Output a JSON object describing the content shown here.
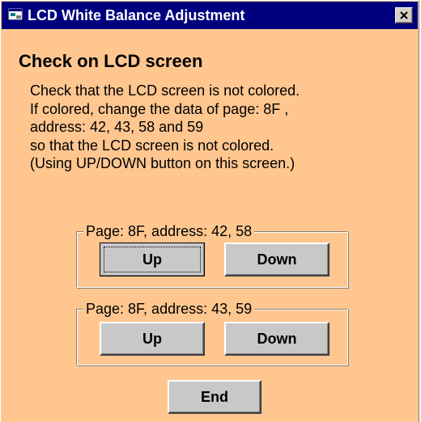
{
  "window": {
    "title": "LCD White Balance Adjustment",
    "close_icon": "close-x-icon",
    "app_icon": "app-window-icon"
  },
  "heading": "Check on LCD screen",
  "instructions": [
    "Check that the LCD screen is not colored.",
    "If colored, change the data of page: 8F ,",
    "address: 42, 43, 58 and 59",
    "so that the LCD screen is not colored.",
    "(Using UP/DOWN button on this screen.)"
  ],
  "groups": [
    {
      "legend": "Page: 8F, address: 42, 58",
      "up_label": "Up",
      "down_label": "Down"
    },
    {
      "legend": "Page: 8F, address: 43, 59",
      "up_label": "Up",
      "down_label": "Down"
    }
  ],
  "end_label": "End",
  "colors": {
    "window_background": "#ffc690",
    "titlebar": "#00007f",
    "button_face": "#c8c8c8"
  }
}
